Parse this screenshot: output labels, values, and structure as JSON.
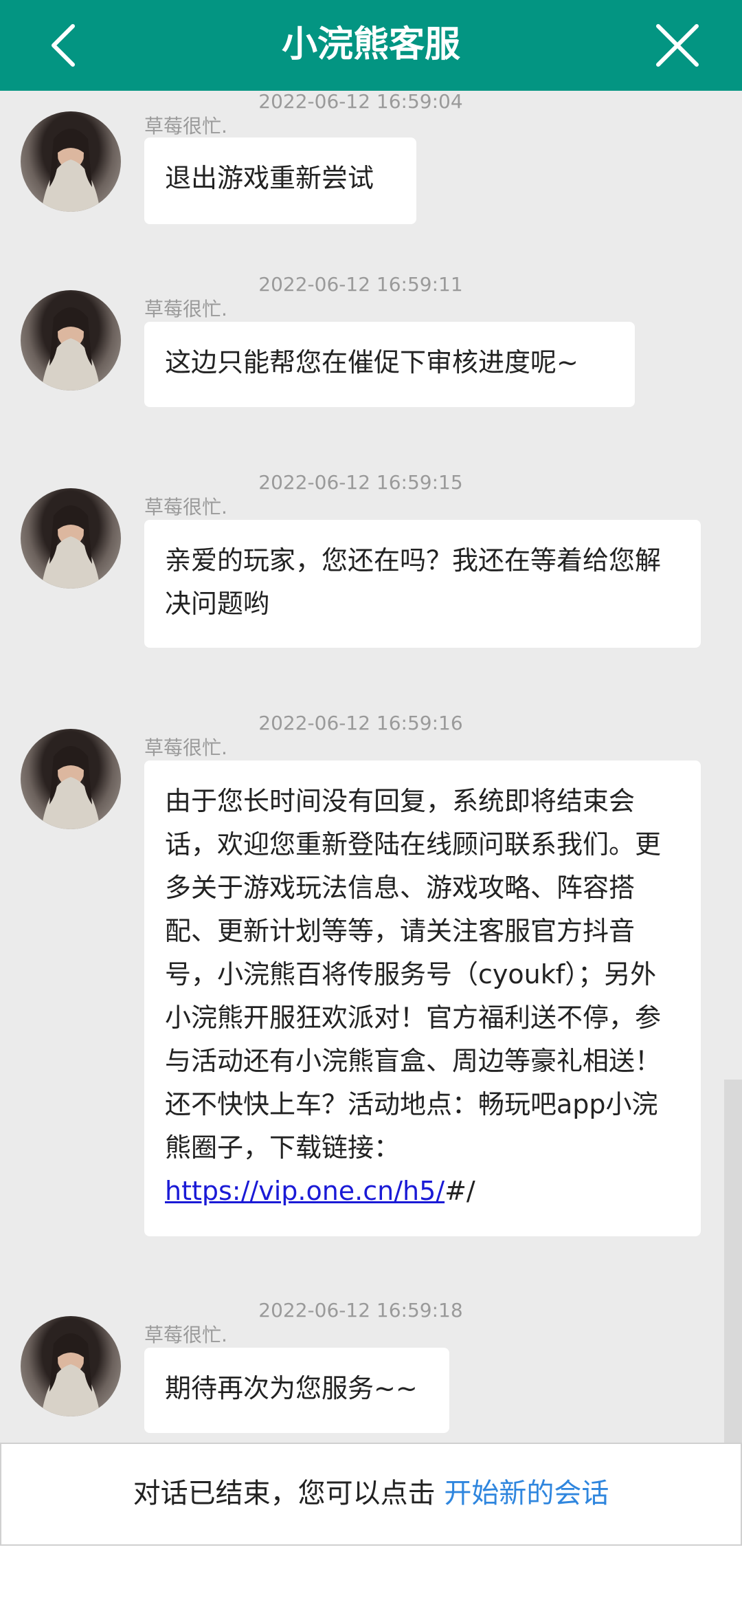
{
  "header": {
    "title": "小浣熊客服",
    "back_icon": "chevron-left-icon",
    "close_icon": "close-icon",
    "color": "#039582"
  },
  "messages": [
    {
      "time": "2022-06-12 16:59:04",
      "sender": "草莓很忙.",
      "text": "退出游戏重新尝试"
    },
    {
      "time": "2022-06-12 16:59:11",
      "sender": "草莓很忙.",
      "text": "这边只能帮您在催促下审核进度呢~"
    },
    {
      "time": "2022-06-12 16:59:15",
      "sender": "草莓很忙.",
      "text": "亲爱的玩家，您还在吗？我还在等着给您解决问题哟"
    },
    {
      "time": "2022-06-12 16:59:16",
      "sender": "草莓很忙.",
      "text": "由于您长时间没有回复，系统即将结束会话，欢迎您重新登陆在线顾问联系我们。更多关于游戏玩法信息、游戏攻略、阵容搭配、更新计划等等，请关注客服官方抖音号，小浣熊百将传服务号（cyoukf）；另外小浣熊开服狂欢派对！官方福利送不停，参与活动还有小浣熊盲盒、周边等豪礼相送！还不快快上车？活动地点：畅玩吧app小浣熊圈子，下载链接：",
      "link_text": "https://vip.one.cn/h5/",
      "after_link": "#/"
    },
    {
      "time": "2022-06-12 16:59:18",
      "sender": "草莓很忙.",
      "text": "期待再次为您服务~~"
    }
  ],
  "footer": {
    "text": "对话已结束，您可以点击 ",
    "link": "开始新的会话",
    "link_color": "#2f86de"
  }
}
